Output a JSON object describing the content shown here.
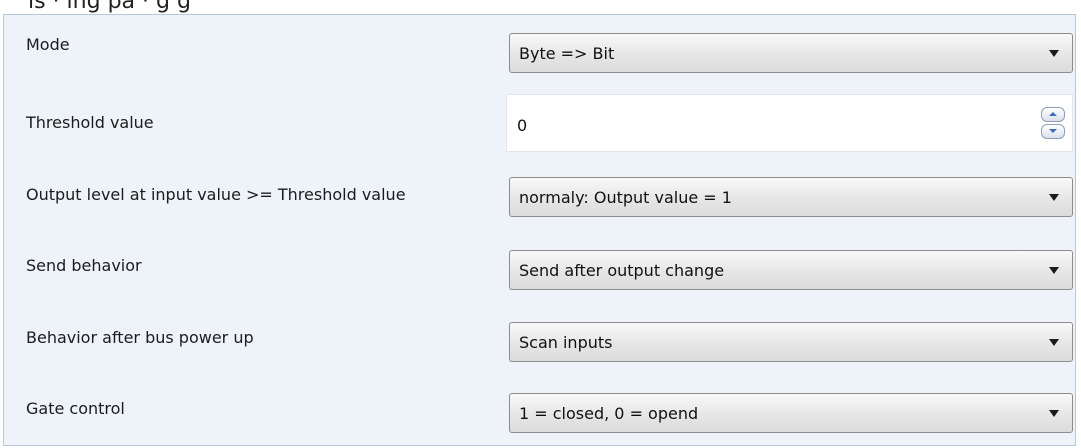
{
  "caption": "ıs · ıng pa                ·   g           g",
  "params": {
    "mode": {
      "label": "Mode",
      "value": "Byte => Bit"
    },
    "threshold": {
      "label": "Threshold value",
      "value": "0"
    },
    "output_level": {
      "label": "Output level at input value >= Threshold value",
      "value": "normaly: Output value = 1"
    },
    "send_behavior": {
      "label": "Send behavior",
      "value": "Send after output change"
    },
    "bus_power_up": {
      "label": "Behavior after bus power up",
      "value": "Scan inputs"
    },
    "gate_control": {
      "label": "Gate control",
      "value": "1 = closed, 0 = opend"
    }
  },
  "icons": {
    "dropdown_arrow": "chevron-down-icon",
    "spin_up": "spin-up-icon",
    "spin_down": "spin-down-icon"
  },
  "colors": {
    "panel_background": "#eef2f9",
    "panel_border": "#b9c7dc",
    "spin_arrow": "#3e6fb0"
  }
}
